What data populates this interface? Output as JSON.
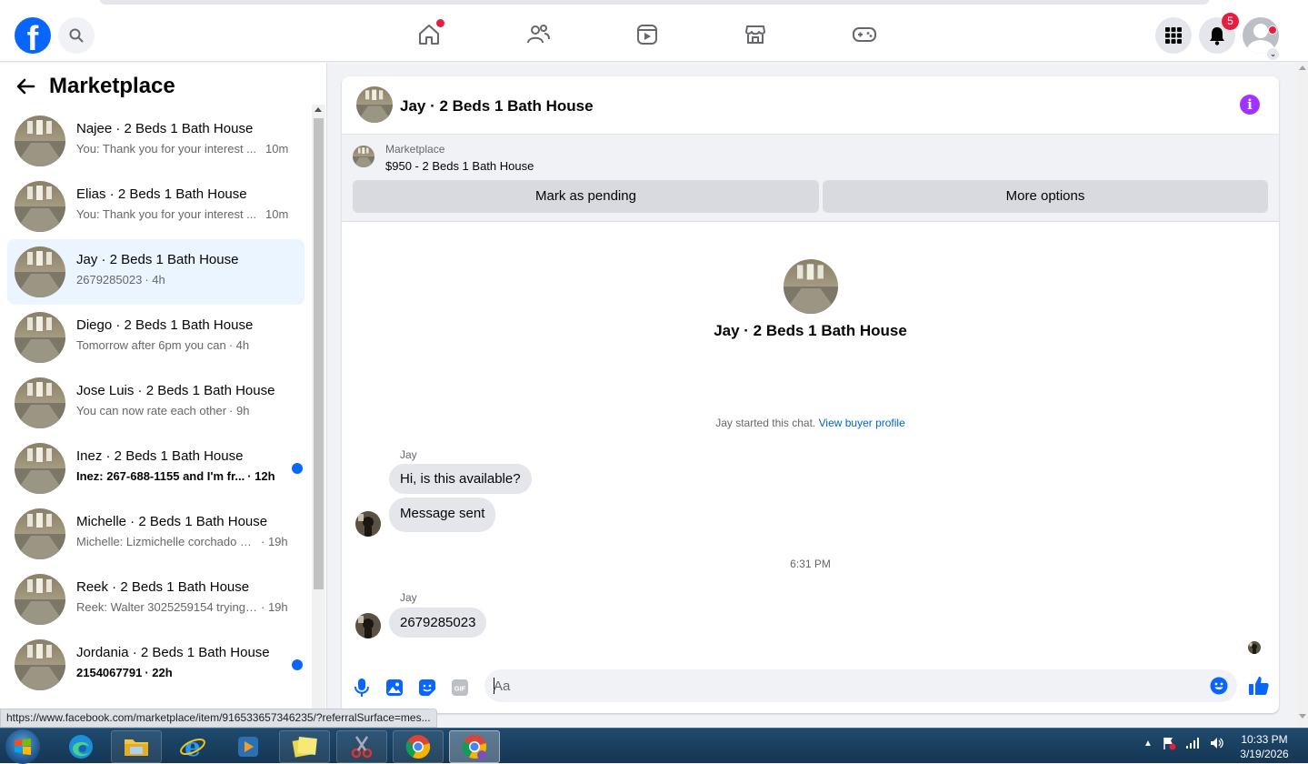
{
  "topnav": {
    "logo": "f",
    "notifications_count": "5",
    "nav": [
      "home",
      "friends",
      "watch",
      "marketplace",
      "gaming"
    ]
  },
  "sidebar": {
    "title": "Marketplace",
    "conversations": [
      {
        "name": "Najee · 2 Beds 1 Bath House",
        "snippet": "You: Thank you for your interest ...",
        "time": "10m",
        "unread": false,
        "active": false
      },
      {
        "name": "Elias · 2 Beds 1 Bath House",
        "snippet": "You: Thank you for your interest ...",
        "time": "10m",
        "unread": false,
        "active": false
      },
      {
        "name": "Jay · 2 Beds 1 Bath House",
        "snippet": "2679285023",
        "time": "· 4h",
        "unread": false,
        "active": true
      },
      {
        "name": "Diego · 2 Beds 1 Bath House",
        "snippet": "Tomorrow after 6pm you can",
        "time": "· 4h",
        "unread": false,
        "active": false
      },
      {
        "name": "Jose Luis · 2 Beds 1 Bath House",
        "snippet": "You can now rate each other",
        "time": "· 9h",
        "unread": false,
        "active": false
      },
      {
        "name": "Inez · 2 Beds 1 Bath House",
        "snippet": "Inez: 267-688-1155 and I'm fr...",
        "time": "· 12h",
        "unread": true,
        "active": false
      },
      {
        "name": "Michelle · 2 Beds 1 Bath House",
        "snippet": "Michelle: Lizmichelle corchado 26...",
        "time": "· 19h",
        "unread": false,
        "active": false
      },
      {
        "name": "Reek · 2 Beds 1 Bath House",
        "snippet": "Reek: Walter 3025259154 trying t...",
        "time": "· 19h",
        "unread": false,
        "active": false
      },
      {
        "name": "Jordania · 2 Beds 1 Bath House",
        "snippet": "2154067791",
        "time": "· 22h",
        "unread": true,
        "active": false
      }
    ]
  },
  "chat": {
    "title": "Jay · 2 Beds 1 Bath House",
    "marketplace_label": "Marketplace",
    "listing": "$950 - 2 Beds 1 Bath House",
    "mark_pending": "Mark as pending",
    "more_options": "More options",
    "intro_name": "Jay · 2 Beds 1 Bath House",
    "started_text": "Jay started this chat.",
    "view_buyer": "View buyer profile",
    "sender1": "Jay",
    "msg1": "Hi, is this available?",
    "msg2": "Message sent",
    "timestamp": "6:31 PM",
    "sender2": "Jay",
    "msg3": "2679285023",
    "composer_placeholder": "Aa"
  },
  "status_url": "https://www.facebook.com/marketplace/item/916533657346235/?referralSurface=mes...",
  "taskbar": {
    "time": "10:33 PM",
    "date": "3/19/2026"
  },
  "colors": {
    "brand": "#0866ff",
    "unread_dot": "#0866ff",
    "notification_red": "#e41e3f",
    "info_purple": "#a033ff",
    "active_row": "#ebf5ff",
    "bubble": "#e4e6eb"
  }
}
